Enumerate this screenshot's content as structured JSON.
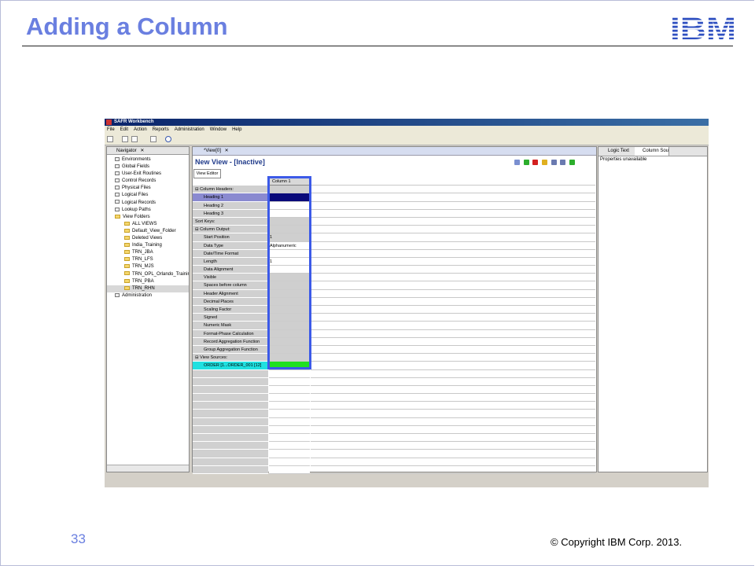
{
  "slide": {
    "title": "Adding a Column",
    "brand": "IBM",
    "page_number": "33",
    "copyright": "© Copyright IBM Corp. 2013."
  },
  "app": {
    "title": "SAFR Workbench",
    "menu": [
      "File",
      "Edit",
      "Action",
      "Reports",
      "Administration",
      "Window",
      "Help"
    ]
  },
  "navigator": {
    "tab_label": "Navigator",
    "items": [
      {
        "label": "Environments",
        "icon": "environments-icon",
        "indent": 0
      },
      {
        "label": "Global Fields",
        "icon": "global-fields-icon",
        "indent": 0
      },
      {
        "label": "User-Exit Routines",
        "icon": "user-exit-icon",
        "indent": 0
      },
      {
        "label": "Control Records",
        "icon": "control-records-icon",
        "indent": 0
      },
      {
        "label": "Physical Files",
        "icon": "physical-files-icon",
        "indent": 0
      },
      {
        "label": "Logical Files",
        "icon": "logical-files-icon",
        "indent": 0
      },
      {
        "label": "Logical Records",
        "icon": "logical-records-icon",
        "indent": 0
      },
      {
        "label": "Lookup Paths",
        "icon": "lookup-paths-icon",
        "indent": 0
      },
      {
        "label": "View Folders",
        "icon": "folder-icon",
        "indent": 0
      },
      {
        "label": "ALL VIEWS",
        "icon": "folder-icon",
        "indent": 1
      },
      {
        "label": "Default_View_Folder",
        "icon": "folder-icon",
        "indent": 1
      },
      {
        "label": "Deleted Views",
        "icon": "folder-icon",
        "indent": 1
      },
      {
        "label": "India_Training",
        "icon": "folder-icon",
        "indent": 1
      },
      {
        "label": "TRN_JBA",
        "icon": "folder-icon",
        "indent": 1
      },
      {
        "label": "TRN_LFS",
        "icon": "folder-icon",
        "indent": 1
      },
      {
        "label": "TRN_MJS",
        "icon": "folder-icon",
        "indent": 1
      },
      {
        "label": "TRN_OPL_Orlando_Trainir",
        "icon": "folder-icon",
        "indent": 1
      },
      {
        "label": "TRN_PBA",
        "icon": "folder-icon",
        "indent": 1
      },
      {
        "label": "TRN_RHN",
        "icon": "folder-icon",
        "indent": 1
      },
      {
        "label": "Administration",
        "icon": "administration-icon",
        "indent": 0
      }
    ],
    "selected_item": "TRN_RHN"
  },
  "editor": {
    "tab_label": "*View[0]",
    "title": "New View - [Inactive]",
    "subtab": "View Editor",
    "column_header": "Column 1",
    "rows": [
      {
        "label": "Column Headers:",
        "type": "section",
        "value": "",
        "cell": "grey"
      },
      {
        "label": "Heading 1",
        "type": "item",
        "value": "",
        "cell": "navy",
        "selected": true
      },
      {
        "label": "Heading 2",
        "type": "item",
        "value": "",
        "cell": "white"
      },
      {
        "label": "Heading 3",
        "type": "item",
        "value": "",
        "cell": "white"
      },
      {
        "label": "Sort Keys:",
        "type": "plain",
        "value": "",
        "cell": "grey"
      },
      {
        "label": "Column Output:",
        "type": "section",
        "value": "",
        "cell": "grey"
      },
      {
        "label": "Start Position",
        "type": "item",
        "value": "1",
        "cell": "grey"
      },
      {
        "label": "Data Type",
        "type": "item",
        "value": "Alphanumeric",
        "cell": "white"
      },
      {
        "label": "Date/Time Format",
        "type": "item",
        "value": "",
        "cell": "white"
      },
      {
        "label": "Length",
        "type": "item",
        "value": "1",
        "cell": "white"
      },
      {
        "label": "Data Alignment",
        "type": "item",
        "value": "",
        "cell": "white"
      },
      {
        "label": "Visible",
        "type": "item",
        "value": "",
        "cell": "grey"
      },
      {
        "label": "Spaces before column",
        "type": "item",
        "value": "",
        "cell": "grey"
      },
      {
        "label": "Header Alignment",
        "type": "item",
        "value": "",
        "cell": "grey"
      },
      {
        "label": "Decimal Places",
        "type": "item",
        "value": "",
        "cell": "grey"
      },
      {
        "label": "Scaling Factor",
        "type": "item",
        "value": "",
        "cell": "grey"
      },
      {
        "label": "Signed",
        "type": "item",
        "value": "",
        "cell": "grey"
      },
      {
        "label": "Numeric Mask",
        "type": "item",
        "value": "",
        "cell": "grey"
      },
      {
        "label": "Format-Phase Calculation",
        "type": "item",
        "value": "",
        "cell": "grey"
      },
      {
        "label": "Record Aggregation Function",
        "type": "item",
        "value": "",
        "cell": "grey"
      },
      {
        "label": "Group Aggregation Function",
        "type": "item",
        "value": "",
        "cell": "grey"
      },
      {
        "label": "View Sources:",
        "type": "section",
        "value": "",
        "cell": "grey"
      },
      {
        "label": "ORDER [1...ORDER_001 [12]",
        "type": "item",
        "value": "",
        "cell": "green",
        "cyan": true
      }
    ],
    "empty_rows": 13
  },
  "right_panel": {
    "tabs": [
      "Logic Text",
      "Column Sou"
    ],
    "text": "Properties unavailable"
  },
  "colors": {
    "title": "#6a7fe0",
    "highlight": "#3c5ae8",
    "ibm_blue": "#2e4fc0"
  }
}
